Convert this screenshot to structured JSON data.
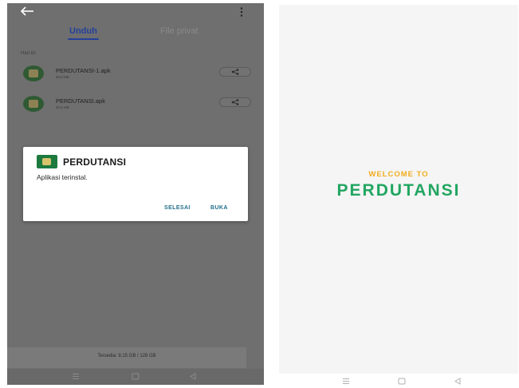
{
  "left_screen": {
    "tabs": [
      "Unduh",
      "File privat"
    ],
    "section_label": "Hari ini",
    "files": [
      {
        "name": "PERDUTANSI-1.apk",
        "size": "92,8 MB"
      },
      {
        "name": "PERDUTANSI.apk",
        "size": "92,8 MB"
      }
    ],
    "dialog": {
      "title": "PERDUTANSI",
      "message": "Aplikasi terinstal.",
      "button_done": "SELESAI",
      "button_open": "BUKA"
    },
    "storage": "Tersedia: 9,15 GB / 128 GB",
    "icons": {
      "back": "arrow-left-icon",
      "more": "more-vertical-icon",
      "share": "share-icon",
      "app": "perdutansi-app-icon"
    }
  },
  "right_screen": {
    "welcome_line": "WELCOME TO",
    "app_name": "PERDUTANSI"
  },
  "colors": {
    "overlay": "#6f6f6f",
    "tab_active": "#24409a",
    "dialog_button": "#1f6e8a",
    "welcome_orange": "#f0ad1e",
    "welcome_green": "#22a661"
  }
}
